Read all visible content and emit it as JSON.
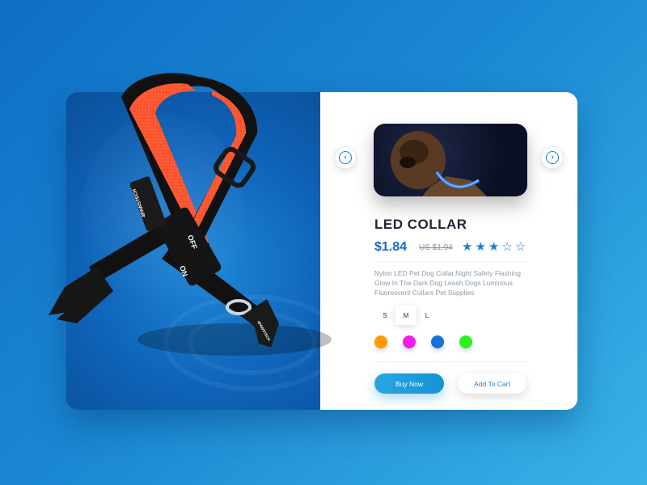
{
  "product": {
    "title": "LED COLLAR",
    "price": "$1.84",
    "old_price": "US $1.94",
    "rating": 3,
    "rating_max": 5,
    "description": "Nylon LED Pet Dog Collar,Night Safety Flashing Glow In The Dark Dog Leash,Dogs Luminous Fluorescent Collars Pet Supplies"
  },
  "gallery": {
    "prev_icon": "chevron-left-icon",
    "next_icon": "chevron-right-icon"
  },
  "sizes": {
    "options": [
      "S",
      "M",
      "L"
    ],
    "selected": "M"
  },
  "colors": {
    "options": [
      "#ff9a00",
      "#f21cf0",
      "#1470e0",
      "#2bf21c"
    ]
  },
  "actions": {
    "buy_label": "Buy Now",
    "cart_label": "Add To Cart"
  },
  "collar": {
    "brand_label": "4PAWSTECH",
    "off_label": "OFF",
    "on_label": "ON",
    "accent_color": "#ff5a34"
  },
  "theme": {
    "accent": "#1b7fd1",
    "price_color": "#166cc4",
    "text_dark": "#1f2733"
  }
}
